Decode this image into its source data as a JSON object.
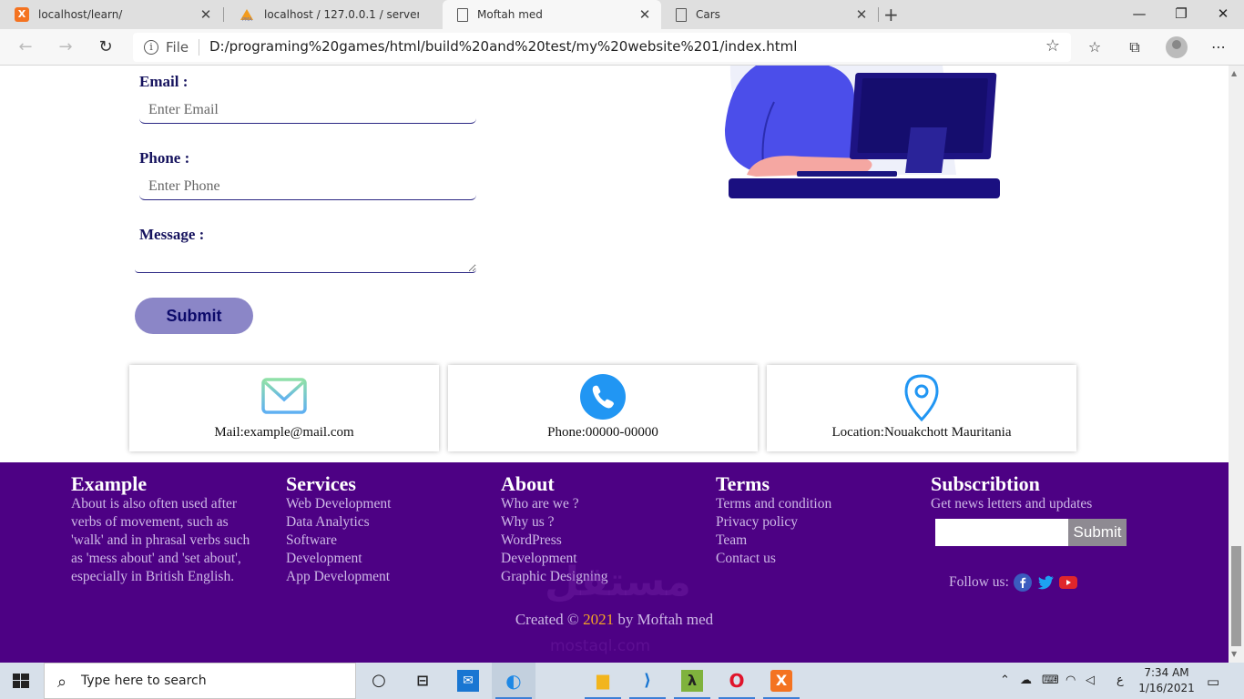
{
  "browser": {
    "tabs": [
      {
        "title": "localhost/learn/",
        "favicon": "xampp-icon"
      },
      {
        "title": "localhost / 127.0.0.1 / server / info",
        "favicon": "phpmyadmin-icon"
      },
      {
        "title": "Moftah med",
        "favicon": "document-icon",
        "active": true
      },
      {
        "title": "Cars",
        "favicon": "document-icon"
      }
    ],
    "address": {
      "scheme_label": "File",
      "url": "D:/programing%20games/html/build%20and%20test/my%20website%201/index.html"
    }
  },
  "form": {
    "email_label": "Email :",
    "email_placeholder": "Enter Email",
    "phone_label": "Phone :",
    "phone_placeholder": "Enter Phone",
    "message_label": "Message :",
    "submit_label": "Submit"
  },
  "contact_cards": [
    {
      "icon": "mail-icon",
      "text": "Mail:example@mail.com"
    },
    {
      "icon": "phone-icon",
      "text": "Phone:00000-00000"
    },
    {
      "icon": "location-pin-icon",
      "text": "Location:Nouakchott Mauritania"
    }
  ],
  "footer": {
    "example": {
      "title": "Example",
      "text": "About is also often used after verbs of movement, such as 'walk' and in phrasal verbs such as 'mess about' and 'set about', especially in British English."
    },
    "services": {
      "title": "Services",
      "links": [
        "Web Development",
        "Data Analytics",
        "Software Development",
        "App Development"
      ]
    },
    "about": {
      "title": "About",
      "links": [
        "Who are we ?",
        "Why us ?",
        "WordPress Development",
        "Graphic Designing"
      ]
    },
    "terms": {
      "title": "Terms",
      "links": [
        "Terms and condition",
        "Privacy policy",
        "Team",
        "Contact us"
      ]
    },
    "subscription": {
      "title": "Subscribtion",
      "text": "Get news letters and updates",
      "button_label": "Submit",
      "follow_label": "Follow us:",
      "social_icons": [
        "facebook-icon",
        "twitter-icon",
        "youtube-icon"
      ]
    },
    "credit_prefix": "Created © ",
    "credit_year": "2021",
    "credit_suffix": " by Moftah med"
  },
  "watermark": {
    "text": "مستقل",
    "sub": "mostaql.com"
  },
  "taskbar": {
    "search_placeholder": "Type here to search",
    "apps": [
      "cortana-icon",
      "task-view-icon",
      "mail-icon",
      "edge-icon",
      "file-explorer-icon",
      "vscode-icon",
      "lambda-app-icon",
      "opera-icon",
      "xampp-icon"
    ],
    "time": "7:34 AM",
    "date": "1/16/2021",
    "language": "ع"
  },
  "colors": {
    "footer_bg": "#4d0184",
    "footer_text": "#cdb8e6",
    "accent_year": "#f6a623",
    "submit_bg": "#8b86c7",
    "label_navy": "#16135e"
  }
}
